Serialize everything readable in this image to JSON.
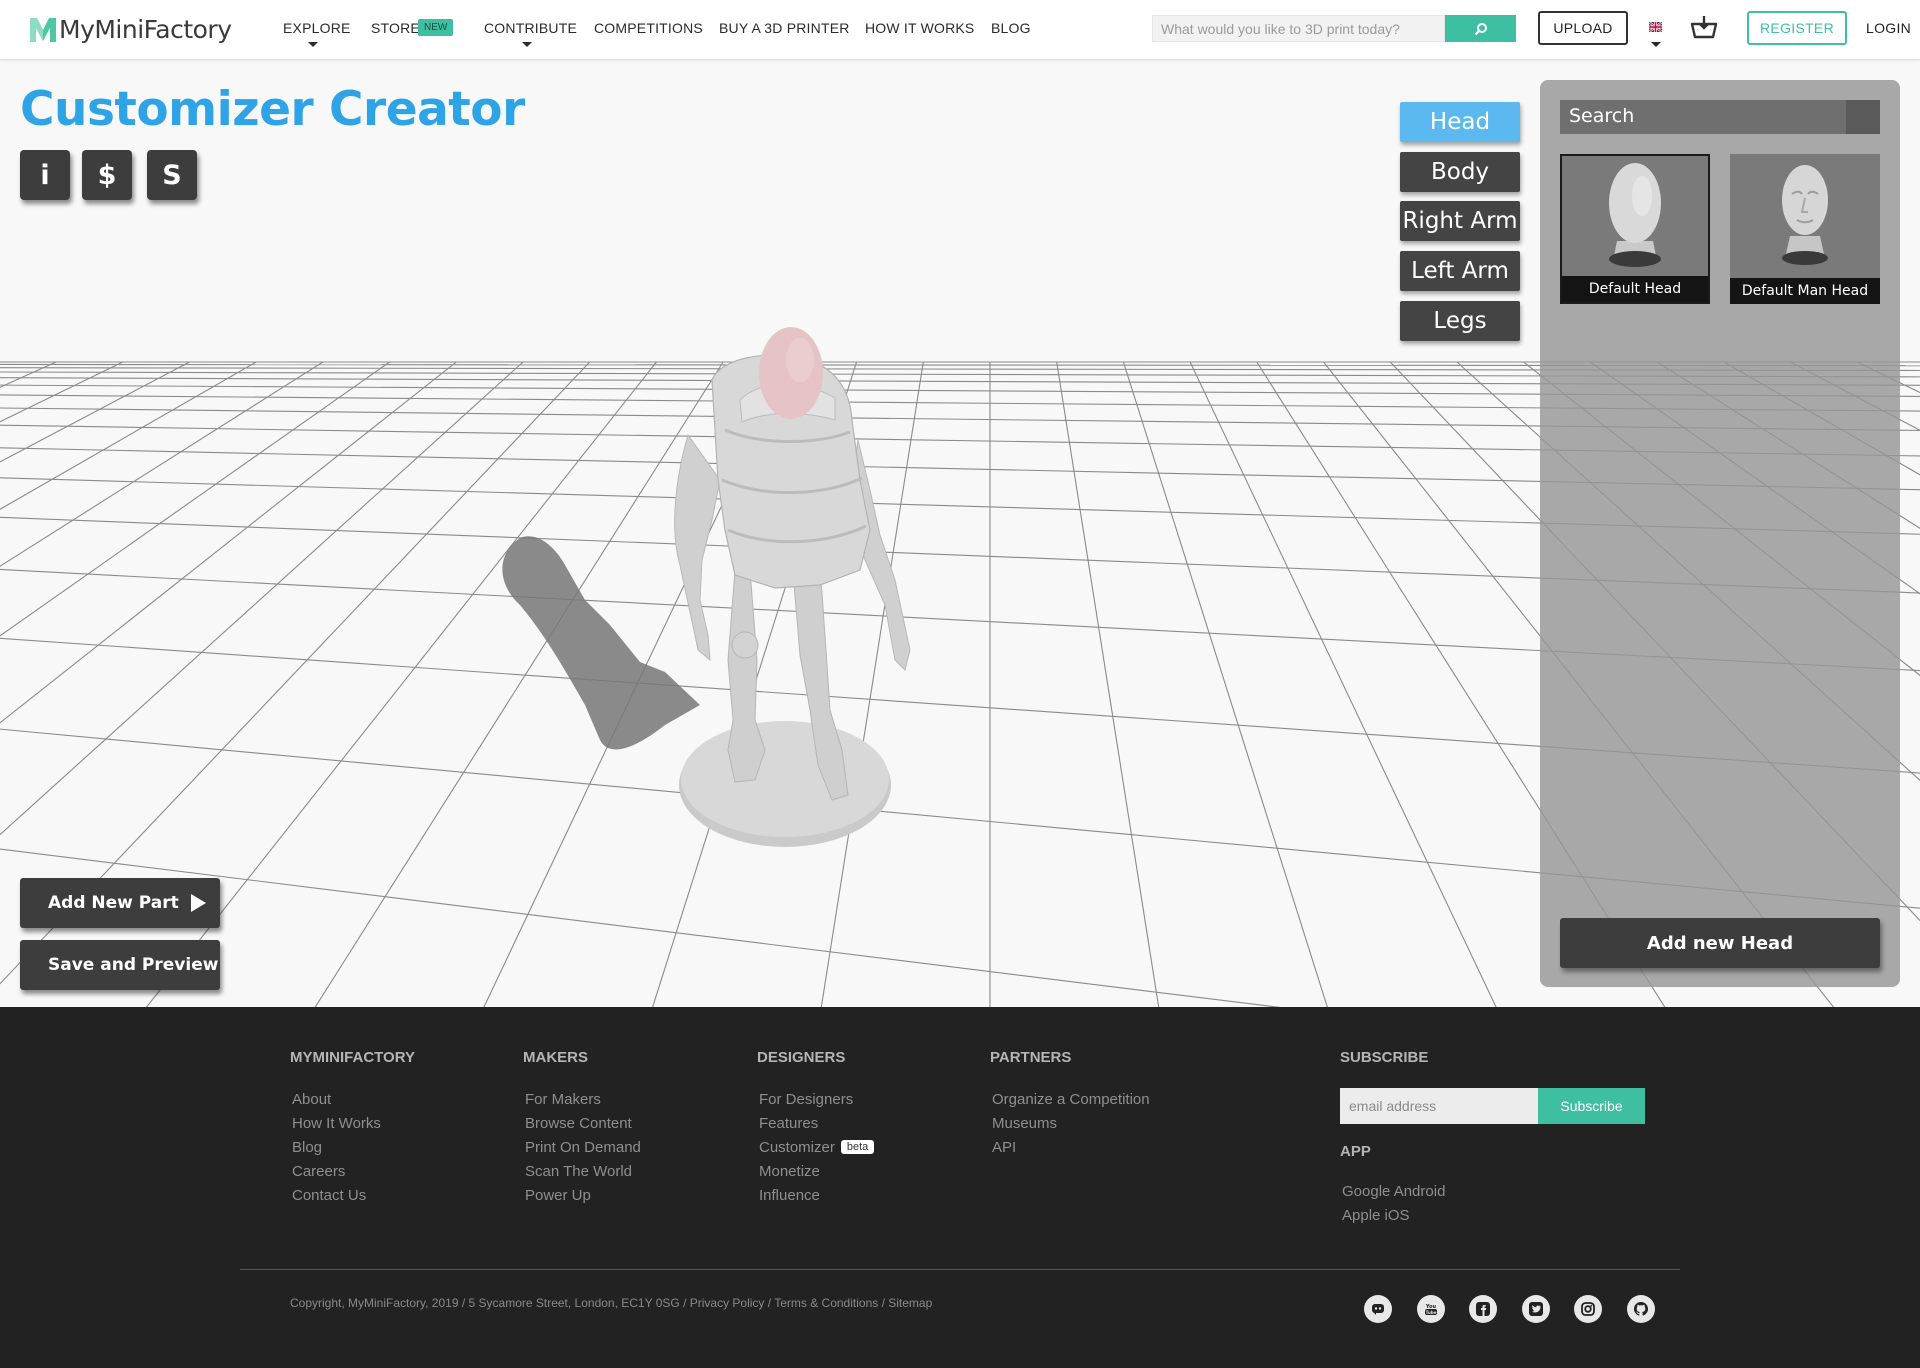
{
  "brand": {
    "name": "MyMiniFactory",
    "accent": "#3fbfa1",
    "title_blue": "#2ea3e6"
  },
  "nav": {
    "items": [
      {
        "label": "EXPLORE"
      },
      {
        "label": "STORE"
      },
      {
        "label": "CONTRIBUTE"
      },
      {
        "label": "COMPETITIONS"
      },
      {
        "label": "BUY A 3D PRINTER"
      },
      {
        "label": "HOW IT WORKS"
      },
      {
        "label": "BLOG"
      }
    ],
    "store_badge": "NEW",
    "search_placeholder": "What would you like to 3D print today?",
    "upload": "UPLOAD",
    "register": "REGISTER",
    "login": "LOGIN"
  },
  "editor": {
    "title": "Customizer Creator",
    "icon_buttons": [
      {
        "label": "i"
      },
      {
        "label": "$"
      },
      {
        "label": "S"
      }
    ],
    "part_tabs": [
      {
        "label": "Head",
        "active": true
      },
      {
        "label": "Body"
      },
      {
        "label": "Right Arm"
      },
      {
        "label": "Left Arm"
      },
      {
        "label": "Legs"
      }
    ],
    "panel": {
      "search_label": "Search",
      "tiles": [
        {
          "label": "Default Head",
          "selected": true
        },
        {
          "label": "Default Man Head"
        }
      ],
      "add_button": "Add new Head"
    },
    "add_part": "Add New Part",
    "save_preview": "Save and Preview"
  },
  "footer": {
    "columns": [
      {
        "heading": "MYMINIFACTORY",
        "links": [
          "About",
          "How It Works",
          "Blog",
          "Careers",
          "Contact Us"
        ]
      },
      {
        "heading": "MAKERS",
        "links": [
          "For Makers",
          "Browse Content",
          "Print On Demand",
          "Scan The World",
          "Power Up"
        ]
      },
      {
        "heading": "DESIGNERS",
        "links": [
          "For Designers",
          "Features",
          "Customizer",
          "Monetize",
          "Influence"
        ]
      },
      {
        "heading": "PARTNERS",
        "links": [
          "Organize a Competition",
          "Museums",
          "API"
        ]
      }
    ],
    "beta_badge": "beta",
    "subscribe_heading": "SUBSCRIBE",
    "email_placeholder": "email address",
    "subscribe_button": "Subscribe",
    "app_heading": "APP",
    "app_links": [
      "Google Android",
      "Apple iOS"
    ],
    "copyright": "Copyright, MyMiniFactory, 2019 / 5 Sycamore Street, London, EC1Y 0SG / Privacy Policy / Terms & Conditions / Sitemap",
    "social_icons": [
      "discord-icon",
      "youtube-icon",
      "facebook-icon",
      "twitter-icon",
      "instagram-icon",
      "github-icon"
    ]
  }
}
